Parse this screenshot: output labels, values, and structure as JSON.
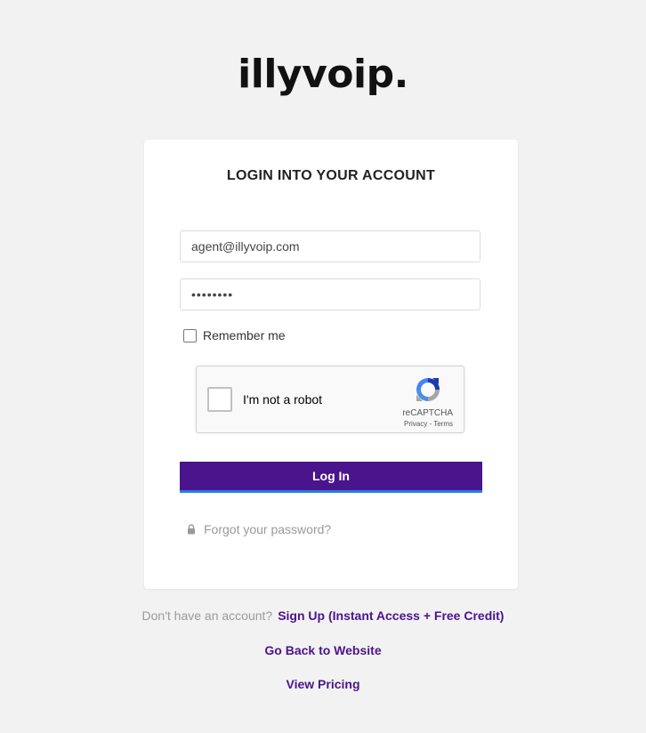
{
  "brand": {
    "logo_text": "illyvoip."
  },
  "login": {
    "title": "LOGIN INTO YOUR ACCOUNT",
    "email_value": "agent@illyvoip.com",
    "password_value": "••••••••",
    "remember_label": "Remember me",
    "remember_checked": false,
    "submit_label": "Log In",
    "forgot_label": "Forgot your password?"
  },
  "captcha": {
    "label": "I'm not a robot",
    "brand": "reCAPTCHA",
    "privacy": "Privacy",
    "separator": " - ",
    "terms": "Terms"
  },
  "footer": {
    "no_account_text": "Don't have an account?",
    "signup_label": "Sign Up (Instant Access + Free Credit)",
    "back_label": "Go Back to Website",
    "pricing_label": "View Pricing"
  },
  "colors": {
    "primary": "#4a148c",
    "accent_underline": "#2a7de1",
    "background": "#f2f2f2",
    "muted_text": "#9a9a9a"
  },
  "icons": {
    "lock": "lock-icon",
    "recaptcha": "recaptcha-logo-icon"
  }
}
